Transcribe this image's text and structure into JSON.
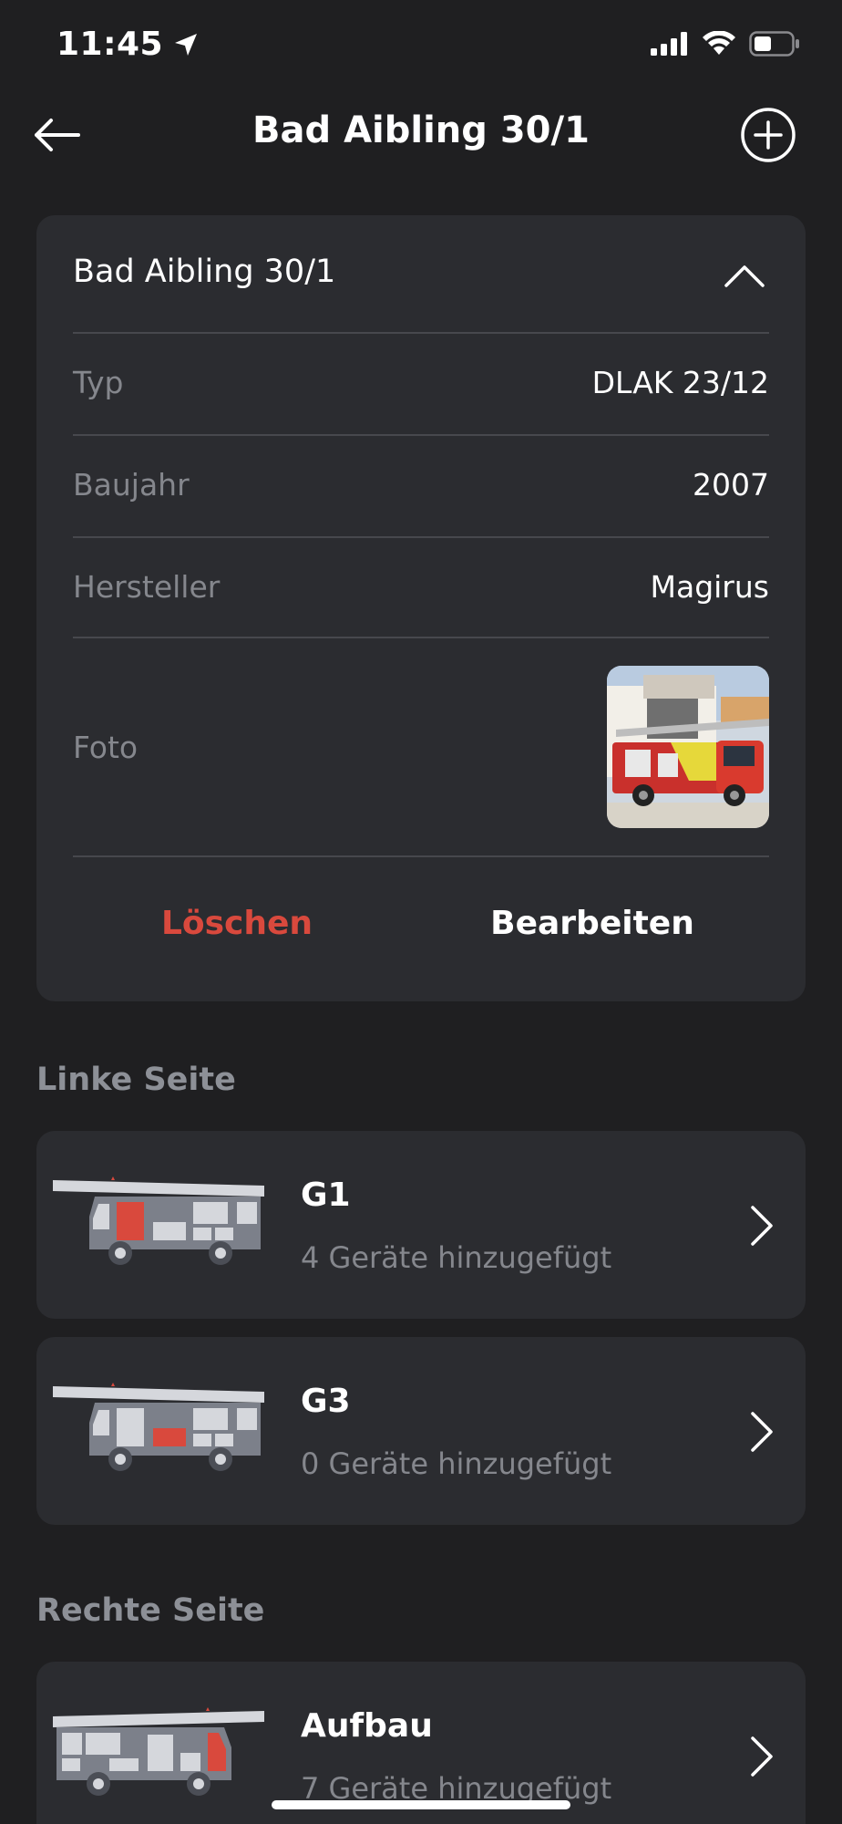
{
  "status_bar": {
    "time": "11:45"
  },
  "nav": {
    "title": "Bad Aibling 30/1"
  },
  "vehicle_card": {
    "title": "Bad Aibling 30/1",
    "rows": [
      {
        "label": "Typ",
        "value": "DLAK 23/12"
      },
      {
        "label": "Baujahr",
        "value": "2007"
      },
      {
        "label": "Hersteller",
        "value": "Magirus"
      }
    ],
    "photo_label": "Foto",
    "delete_label": "Löschen",
    "edit_label": "Bearbeiten"
  },
  "sections": [
    {
      "heading": "Linke Seite",
      "items": [
        {
          "title": "G1",
          "subtitle": "4 Geräte hinzugefügt"
        },
        {
          "title": "G3",
          "subtitle": "0 Geräte hinzugefügt"
        }
      ]
    },
    {
      "heading": "Rechte Seite",
      "items": [
        {
          "title": "Aufbau",
          "subtitle": "7 Geräte hinzugefügt"
        }
      ]
    }
  ],
  "colors": {
    "background": "#1f1f21",
    "card": "#2b2c30",
    "accent_delete": "#d9493d",
    "muted_text": "#85878d"
  },
  "icons": [
    "location-arrow-icon",
    "signal-icon",
    "wifi-icon",
    "battery-icon",
    "back-arrow-icon",
    "add-circle-icon",
    "chevron-up-icon",
    "chevron-right-icon"
  ]
}
